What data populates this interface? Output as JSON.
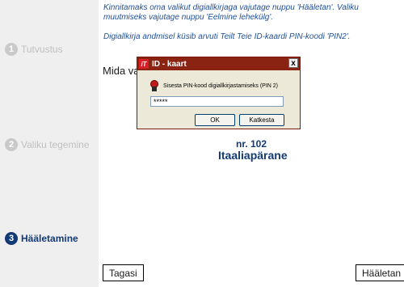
{
  "sidebar": {
    "steps": [
      {
        "number": "1",
        "label": "Tutvustus"
      },
      {
        "number": "2",
        "label": "Valiku tegemine"
      },
      {
        "number": "3",
        "label": "Hääletamine"
      }
    ]
  },
  "main": {
    "info_line1": "Kinnitamaks oma valikut digiallkirjaga vajutage nuppu 'Hääletan'. Valiku muutmiseks vajutage nuppu 'Eelmine lehekülg'.",
    "info_line2": "Digiallkirja andmisel küsib arvuti Teilt Teie ID-kaardi PIN-koodi 'PIN2'.",
    "question": "Mida va",
    "candidate_number": "nr. 102",
    "candidate_name": "Itaaliapärane",
    "back_label": "Tagasi",
    "vote_label": "Hääletan"
  },
  "dialog": {
    "logo_text": "iT",
    "title": "ID - kaart",
    "close_label": "x",
    "prompt": "Sisesta PIN-kood digiallkirjastamiseks (PIN 2)",
    "pin_value": "*****",
    "ok_label": "OK",
    "cancel_label": "Katkesta"
  }
}
